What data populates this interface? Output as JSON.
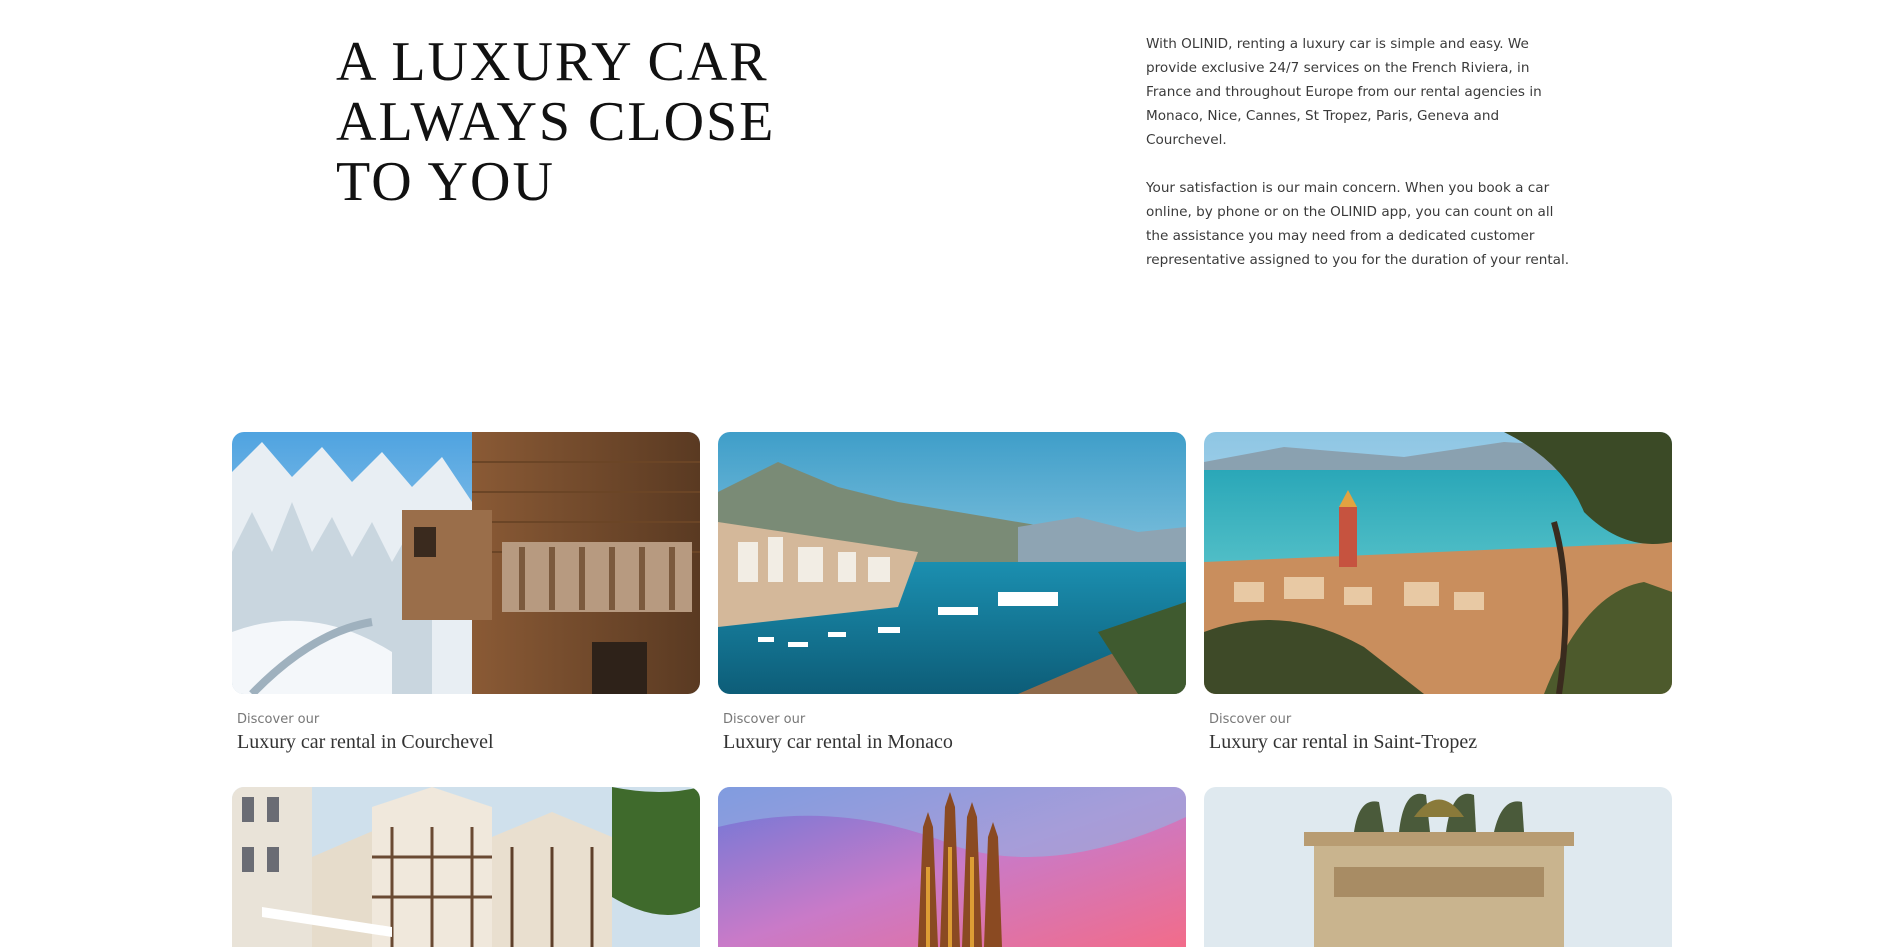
{
  "hero": {
    "title_lines": [
      "A LUXURY CAR",
      "ALWAYS CLOSE",
      "TO YOU"
    ],
    "paragraphs": [
      "With OLINID, renting a luxury car is simple and easy. We provide exclusive 24/7 services on the French Riviera, in France and throughout Europe from our rental agencies in Monaco, Nice, Cannes, St Tropez, Paris, Geneva and Courchevel.",
      "Your satisfaction is our main concern. When you book a car online, by phone or on the OLINID app, you can count on all the assistance you may need from a dedicated customer representative assigned to you for the duration of your rental."
    ]
  },
  "destinations": [
    {
      "eyebrow": "Discover our",
      "title": "Luxury car rental in Courchevel",
      "image": "snowy-chalet-photo"
    },
    {
      "eyebrow": "Discover our",
      "title": "Luxury car rental in Monaco",
      "image": "monaco-harbor-photo"
    },
    {
      "eyebrow": "Discover our",
      "title": "Luxury car rental in Saint-Tropez",
      "image": "saint-tropez-bay-photo"
    },
    {
      "image": "half-timbered-town-photo"
    },
    {
      "image": "cathedral-sunset-photo"
    },
    {
      "image": "arch-quadriga-photo"
    }
  ]
}
